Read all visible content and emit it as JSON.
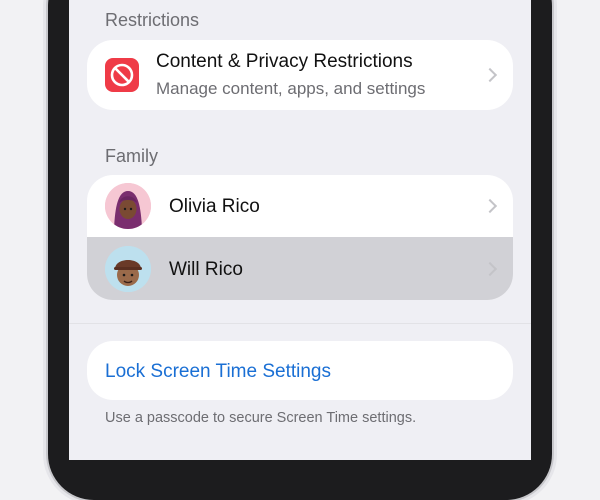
{
  "restrictions": {
    "header": "Restrictions",
    "item": {
      "title": "Content & Privacy Restrictions",
      "subtitle": "Manage content, apps, and settings",
      "icon": "no-entry-icon",
      "icon_color": "#ef3b47"
    }
  },
  "family": {
    "header": "Family",
    "members": [
      {
        "name": "Olivia Rico",
        "avatar": "memoji-avatar-olivia",
        "selected": false
      },
      {
        "name": "Will Rico",
        "avatar": "memoji-avatar-will",
        "selected": true
      }
    ]
  },
  "lock": {
    "label": "Lock Screen Time Settings",
    "footnote": "Use a passcode to secure Screen Time settings.",
    "link_color": "#1a6fd4"
  },
  "colors": {
    "background": "#efeff4",
    "selected_row": "#d1d1d6"
  }
}
